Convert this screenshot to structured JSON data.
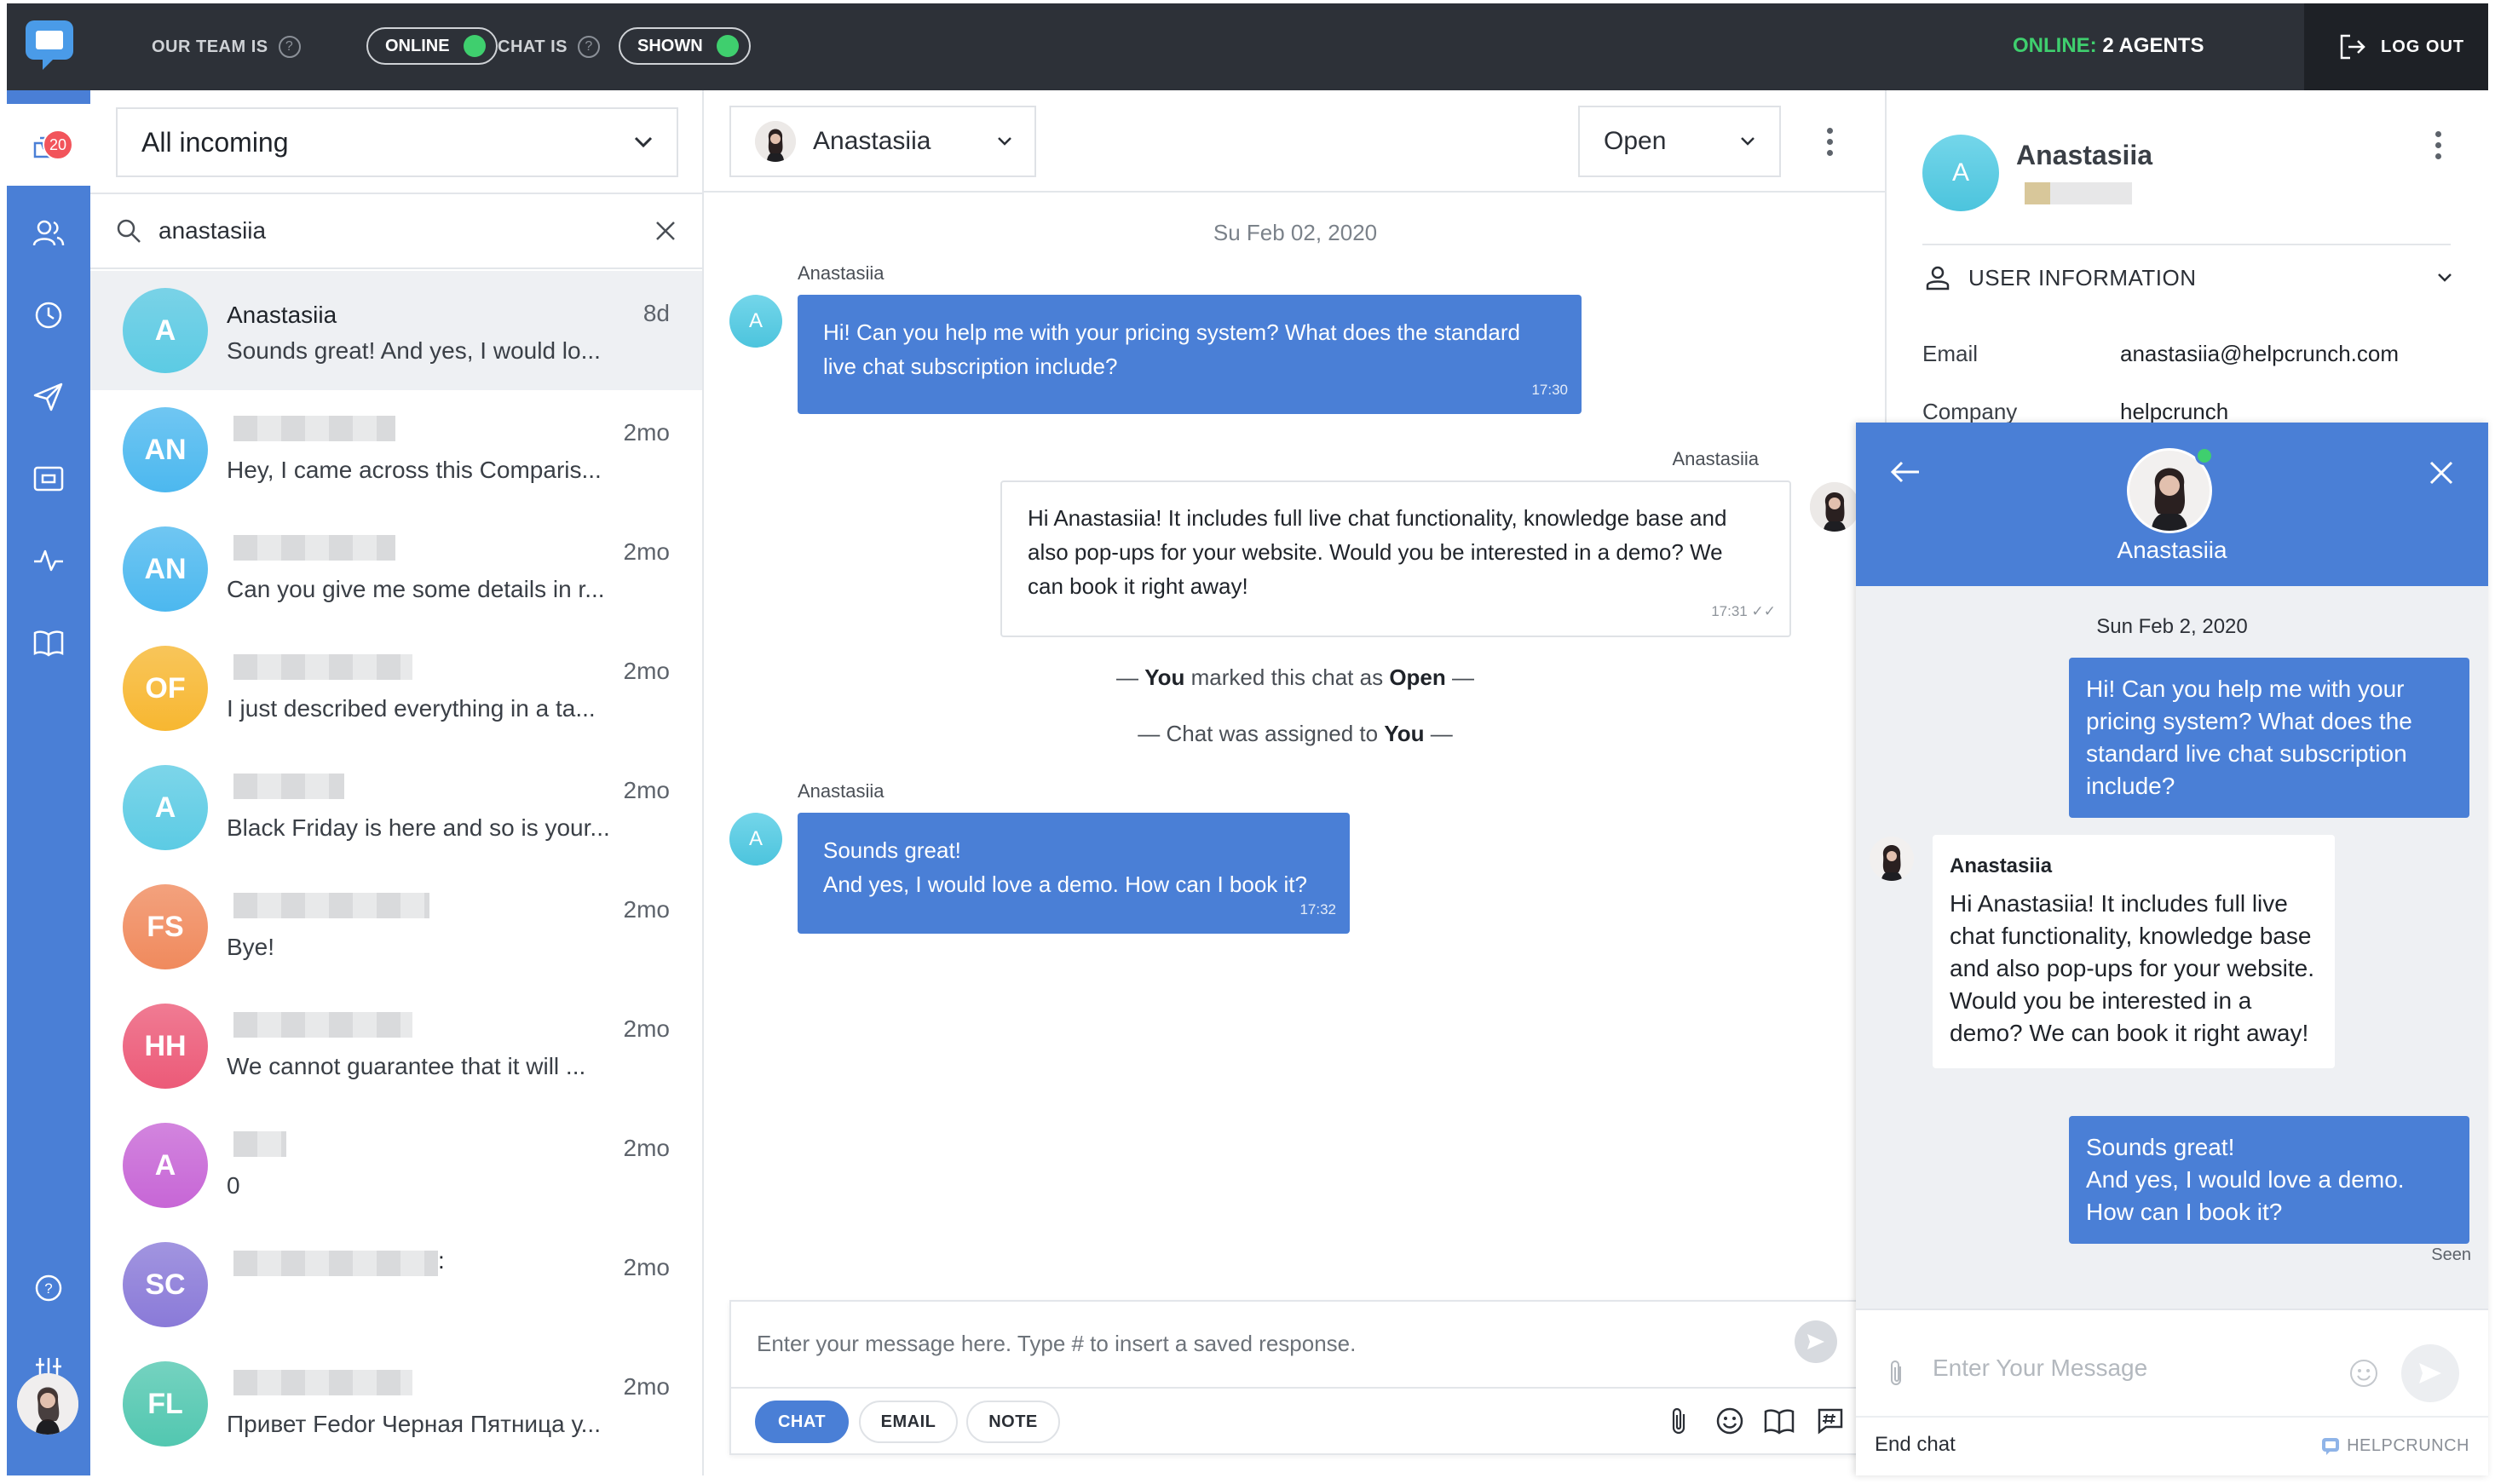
{
  "topbar": {
    "team_label": "OUR TEAM IS",
    "team_status": "ONLINE",
    "chat_label": "CHAT IS",
    "chat_status": "SHOWN",
    "online_label": "ONLINE:",
    "online_value": "2 AGENTS",
    "logout_label": "LOG OUT"
  },
  "rail": {
    "inbox_badge": "20",
    "items": [
      "inbox-icon",
      "contacts-icon",
      "clock-icon",
      "send-icon",
      "card-icon",
      "pulse-icon",
      "book-icon",
      "help-icon",
      "settings-icon"
    ]
  },
  "list": {
    "filter": "All incoming",
    "search_value": "anastasiia",
    "conversations": [
      {
        "initials": "A",
        "name": "Anastasiia",
        "time": "8d",
        "preview": "Sounds great! And yes, I would lo...",
        "color": "#5ccbe4",
        "blur_width": 0
      },
      {
        "initials": "AN",
        "name": "",
        "time": "2mo",
        "preview": "Hey, I came across this Comparis...",
        "color": "#4cb8ef",
        "blur_width": 190
      },
      {
        "initials": "AN",
        "name": "",
        "time": "2mo",
        "preview": "Can you give me some details in r...",
        "color": "#4cb8ef",
        "blur_width": 190
      },
      {
        "initials": "OF",
        "name": "",
        "time": "2mo",
        "preview": "I just described everything in a ta...",
        "color": "#f7b731",
        "blur_width": 210
      },
      {
        "initials": "A",
        "name": "",
        "time": "2mo",
        "preview": "Black Friday is here and so is your...",
        "color": "#5ccbe4",
        "blur_width": 130
      },
      {
        "initials": "FS",
        "name": "",
        "time": "2mo",
        "preview": "Bye!",
        "color": "#f08a5d",
        "blur_width": 230
      },
      {
        "initials": "HH",
        "name": "",
        "time": "2mo",
        "preview": "We cannot guarantee that it will ...",
        "color": "#ec5a78",
        "blur_width": 210
      },
      {
        "initials": "A",
        "name": "",
        "time": "2mo",
        "preview": "0",
        "color": "#c766d6",
        "blur_width": 62
      },
      {
        "initials": "SC",
        "name": "",
        "time": "2mo",
        "preview": "",
        "color": "#8a7ad8",
        "blur_width": 240,
        "name_suffix": ":"
      },
      {
        "initials": "FL",
        "name": "",
        "time": "2mo",
        "preview": "Привет Fedor Черная Пятница у...",
        "color": "#52c7b0",
        "blur_width": 210
      }
    ]
  },
  "chat": {
    "assignee": "Anastasiia",
    "status": "Open",
    "date": "Su Feb 02, 2020",
    "msg1_author": "Anastasiia",
    "msg1_text": "Hi! Can you help me with your pricing system? What does the standard live chat subscription include?",
    "msg1_time": "17:30",
    "msg2_author": "Anastasiia",
    "msg2_text": "Hi Anastasiia! It includes full live chat functionality, knowledge base and also pop-ups for your website. Would you be interested in a demo? We can book it right away!",
    "msg2_time": "17:31",
    "sys1_pre": "— ",
    "sys1_actor": "You",
    "sys1_mid": " marked this chat as ",
    "sys1_state": "Open",
    "sys1_post": " —",
    "sys2_pre": "— Chat was assigned to ",
    "sys2_actor": "You",
    "sys2_post": " —",
    "msg3_author": "Anastasiia",
    "msg3_line1": "Sounds great!",
    "msg3_line2": "And yes, I would love a demo. How can I book it?",
    "msg3_time": "17:32",
    "composer_placeholder": "Enter your message here. Type # to insert a saved response.",
    "mode_chat": "CHAT",
    "mode_email": "EMAIL",
    "mode_note": "NOTE"
  },
  "info": {
    "initial": "A",
    "name": "Anastasiia",
    "section_title": "USER INFORMATION",
    "email_key": "Email",
    "email_value": "anastasiia@helpcrunch.com",
    "company_key": "Company",
    "company_value": "helpcrunch"
  },
  "widget": {
    "agent_name": "Anastasiia",
    "date": "Sun Feb 2, 2020",
    "out1": "Hi! Can you help me with your pricing system? What does the standard live chat subscription include?",
    "in_author": "Anastasiia",
    "in_text": "Hi Anastasiia! It includes full live chat functionality, knowledge base and also pop-ups for your website. Would you be interested in a demo? We can book it right away!",
    "out2_line1": "Sounds great!",
    "out2_line2": "And yes, I would love a demo. How can I book it?",
    "seen": "Seen",
    "input_placeholder": "Enter Your Message",
    "end_chat": "End chat",
    "brand": "HELPCRUNCH"
  },
  "colors": {
    "accent": "#4a7fd6",
    "topbar": "#2d3138",
    "online": "#3fcf6e",
    "badge": "#f2545b"
  }
}
